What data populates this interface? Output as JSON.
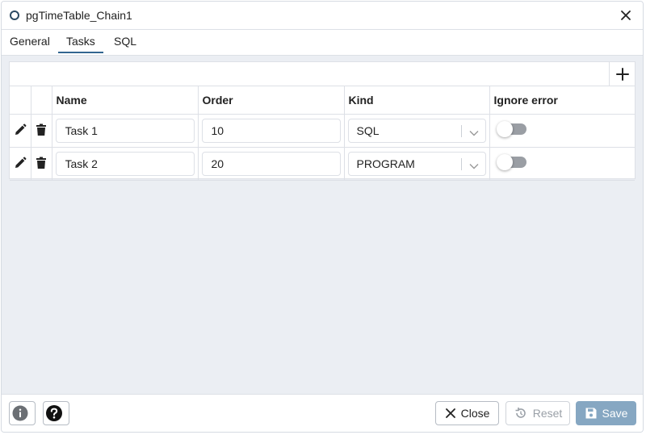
{
  "dialog": {
    "title": "pgTimeTable_Chain1"
  },
  "tabs": [
    {
      "label": "General"
    },
    {
      "label": "Tasks"
    },
    {
      "label": "SQL"
    }
  ],
  "active_tab": "Tasks",
  "grid": {
    "columns": {
      "name": "Name",
      "order": "Order",
      "kind": "Kind",
      "ignore_error": "Ignore error"
    },
    "rows": [
      {
        "name": "Task 1",
        "order": "10",
        "kind": "SQL",
        "ignore_error": false
      },
      {
        "name": "Task 2",
        "order": "20",
        "kind": "PROGRAM",
        "ignore_error": false
      }
    ]
  },
  "footer": {
    "close_label": "Close",
    "reset_label": "Reset",
    "save_label": "Save"
  },
  "icons": {
    "title": "circle-outline-icon",
    "close": "close-icon",
    "add": "plus-icon",
    "edit": "pencil-icon",
    "delete": "trash-icon",
    "info": "info-icon",
    "help": "help-icon",
    "reset": "reset-icon",
    "save": "floppy-disk-icon"
  },
  "colors": {
    "accent": "#326690",
    "save_button": "#86a7c2",
    "background": "#ebeef3"
  }
}
